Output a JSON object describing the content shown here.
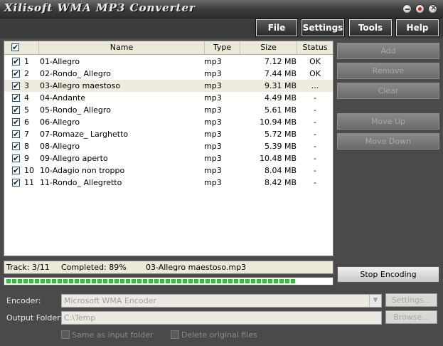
{
  "window": {
    "title": "Xilisoft WMA MP3 Converter"
  },
  "menu": {
    "file": "File",
    "settings": "Settings",
    "tools": "Tools",
    "help": "Help"
  },
  "list": {
    "headers": {
      "name": "Name",
      "type": "Type",
      "size": "Size",
      "status": "Status"
    },
    "rows": [
      {
        "num": "1",
        "name": "01-Allegro",
        "type": "mp3",
        "size": "7.12 MB",
        "status": "OK"
      },
      {
        "num": "2",
        "name": "02-Rondo_ Allegro",
        "type": "mp3",
        "size": "7.44 MB",
        "status": "OK"
      },
      {
        "num": "3",
        "name": "03-Allegro maestoso",
        "type": "mp3",
        "size": "9.31 MB",
        "status": "..."
      },
      {
        "num": "4",
        "name": "04-Andante",
        "type": "mp3",
        "size": "4.49 MB",
        "status": "-"
      },
      {
        "num": "5",
        "name": "05-Rondo_ Allegro",
        "type": "mp3",
        "size": "5.61 MB",
        "status": "-"
      },
      {
        "num": "6",
        "name": "06-Allegro",
        "type": "mp3",
        "size": "10.94 MB",
        "status": "-"
      },
      {
        "num": "7",
        "name": "07-Romaze_ Larghetto",
        "type": "mp3",
        "size": "5.72 MB",
        "status": "-"
      },
      {
        "num": "8",
        "name": "08-Allegro",
        "type": "mp3",
        "size": "5.39 MB",
        "status": "-"
      },
      {
        "num": "9",
        "name": "09-Allegro aperto",
        "type": "mp3",
        "size": "10.48 MB",
        "status": "-"
      },
      {
        "num": "10",
        "name": "10-Adagio non troppo",
        "type": "mp3",
        "size": "8.04 MB",
        "status": "-"
      },
      {
        "num": "11",
        "name": "11-Rondo_ Allegretto",
        "type": "mp3",
        "size": "8.42 MB",
        "status": "-"
      }
    ]
  },
  "side_buttons": {
    "add": "Add",
    "remove": "Remove",
    "clear": "Clear",
    "move_up": "Move Up",
    "move_down": "Move Down",
    "stop": "Stop Encoding"
  },
  "status": {
    "track": "Track: 3/11",
    "completed": "Completed: 89%",
    "file": "03-Allegro maestoso.mp3"
  },
  "progress": {
    "fraction": 0.89
  },
  "encoder": {
    "label": "Encoder:",
    "value": "Microsoft WMA Encoder",
    "settings_btn": "Settings..."
  },
  "output": {
    "label": "Output Folder:",
    "value": "C:\\Temp",
    "browse_btn": "Browse..."
  },
  "options": {
    "same_as_input": "Same as input folder",
    "delete_original": "Delete original files"
  }
}
